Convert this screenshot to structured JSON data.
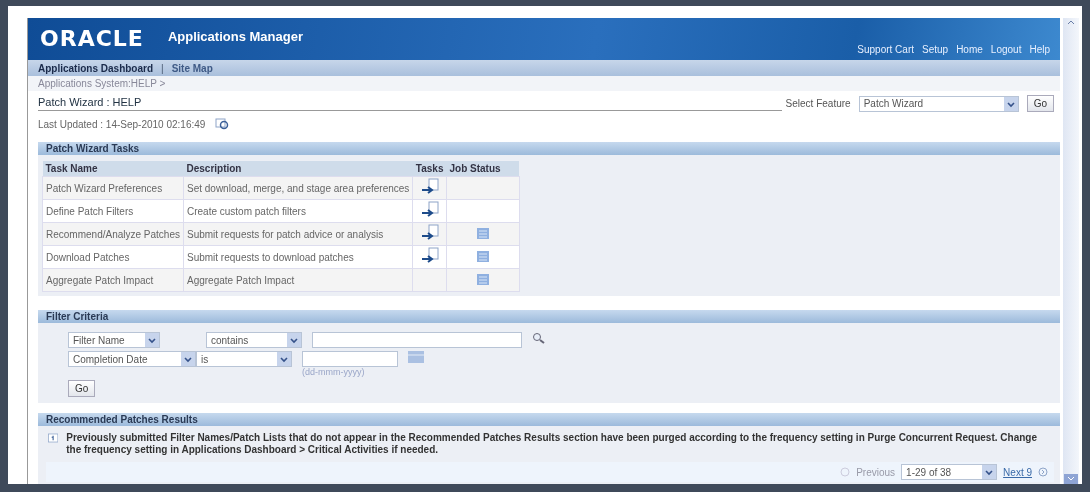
{
  "header": {
    "logo": "ORACLE",
    "title": "Applications Manager",
    "links": [
      "Support Cart",
      "Setup",
      "Home",
      "Logout",
      "Help"
    ]
  },
  "nav": {
    "tabs": [
      {
        "label": "Applications Dashboard",
        "selected": true
      },
      {
        "label": "Site Map",
        "selected": false
      }
    ],
    "separator": "|"
  },
  "breadcrumb": "Applications System:HELP >",
  "page_title": "Patch Wizard : HELP",
  "feature": {
    "label": "Select Feature",
    "value": "Patch Wizard",
    "button": "Go"
  },
  "last_updated": "Last Updated : 14-Sep-2010 02:16:49",
  "tasks": {
    "title": "Patch Wizard Tasks",
    "columns": [
      "Task Name",
      "Description",
      "Tasks",
      "Job Status"
    ],
    "rows": [
      {
        "name": "Patch Wizard Preferences",
        "description": "Set download, merge, and stage area preferences",
        "has_task_icon": true,
        "has_status_icon": false
      },
      {
        "name": "Define Patch Filters",
        "description": "Create custom patch filters",
        "has_task_icon": true,
        "has_status_icon": false
      },
      {
        "name": "Recommend/Analyze Patches",
        "description": "Submit requests for patch advice or analysis",
        "has_task_icon": true,
        "has_status_icon": true
      },
      {
        "name": "Download Patches",
        "description": "Submit requests to download patches",
        "has_task_icon": true,
        "has_status_icon": true
      },
      {
        "name": "Aggregate Patch Impact",
        "description": "Aggregate Patch Impact",
        "has_task_icon": false,
        "has_status_icon": true
      }
    ]
  },
  "filter": {
    "title": "Filter Criteria",
    "rows": [
      {
        "kind": "text",
        "field": "Filter Name",
        "operator": "contains"
      },
      {
        "kind": "date",
        "field": "Completion Date",
        "operator": "is",
        "hint": "(dd-mmm-yyyy)"
      }
    ],
    "button": "Go"
  },
  "results": {
    "title": "Recommended Patches Results",
    "info": "Previously submitted Filter Names/Patch Lists that do not appear in the Recommended Patches Results section have been purged according to the frequency setting in Purge Concurrent Request. Change the frequency setting in Applications Dashboard > Critical Activities if needed.",
    "pager": {
      "previous": "Previous",
      "range": "1-29 of 38",
      "next": "Next 9",
      "previous_disabled": true
    }
  }
}
